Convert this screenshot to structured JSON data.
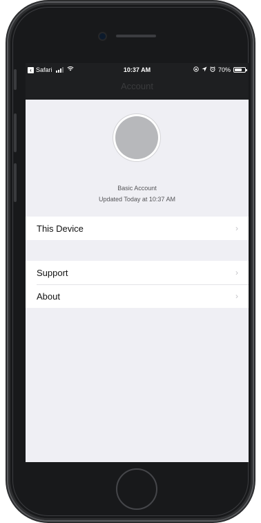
{
  "status_bar": {
    "back_app": "Safari",
    "time": "10:37 AM",
    "battery": "70%",
    "battery_level": 0.7
  },
  "nav": {
    "title": "Account"
  },
  "profile": {
    "account_type": "Basic Account",
    "updated": "Updated Today at 10:37 AM"
  },
  "sections": {
    "device": {
      "items": [
        {
          "label": "This Device"
        }
      ]
    },
    "info": {
      "items": [
        {
          "label": "Support"
        },
        {
          "label": "About"
        }
      ]
    }
  },
  "icons": {
    "back": "back-chevron-icon",
    "signal": "cellular-signal-icon",
    "wifi": "wifi-icon",
    "location": "location-icon",
    "alarm": "alarm-icon",
    "lock_rotation": "orientation-lock-icon",
    "battery": "battery-icon",
    "disclosure": "chevron-right-icon"
  },
  "colors": {
    "nav_background": "#1e1f21",
    "screen_background": "#efeff4",
    "avatar": "#b7b8bb"
  }
}
